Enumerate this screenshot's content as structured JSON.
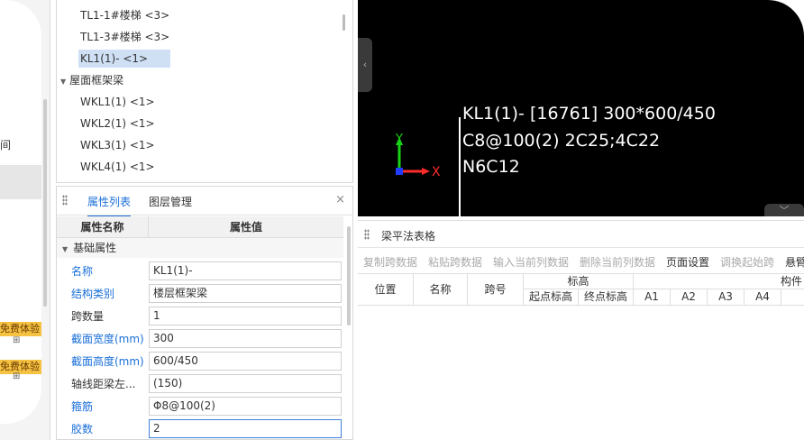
{
  "left_strip": {
    "fragment": "间",
    "badge1": "免费体验",
    "badge2": "免费体验",
    "plus1": "⊞",
    "plus2": "⊞"
  },
  "tree": {
    "items": [
      {
        "label": "TL1-1#楼梯 <3>"
      },
      {
        "label": "TL1-3#楼梯 <3>"
      },
      {
        "label": "KL1(1)- <1>"
      }
    ],
    "group": {
      "label": "屋面框架梁",
      "arrow": "▼"
    },
    "sub_items": [
      {
        "label": "WKL1(1) <1>"
      },
      {
        "label": "WKL2(1) <1>"
      },
      {
        "label": "WKL3(1) <1>"
      },
      {
        "label": "WKL4(1) <1>"
      }
    ]
  },
  "props": {
    "tab_props": "属性列表",
    "tab_layers": "图层管理",
    "close": "×",
    "head_name": "属性名称",
    "head_value": "属性值",
    "group": "基础属性",
    "group_arrow": "▼",
    "rows": [
      {
        "label": "名称",
        "value": "KL1(1)-"
      },
      {
        "label": "结构类别",
        "value": "楼层框架梁"
      },
      {
        "label": "跨数量",
        "value": "1"
      },
      {
        "label": "截面宽度(mm)",
        "value": "300"
      },
      {
        "label": "截面高度(mm)",
        "value": "600/450"
      },
      {
        "label": "轴线距梁左...",
        "value": "(150)"
      },
      {
        "label": "箍筋",
        "value": "Φ8@100(2)"
      },
      {
        "label": "胶数",
        "value": "2"
      }
    ]
  },
  "canvas": {
    "line1": "KL1(1)- [16761] 300*600/450",
    "line2": "C8@100(2) 2C25;4C22",
    "line3": "N6C12",
    "axis_x": "X",
    "axis_y": "Y",
    "left_handle": "‹",
    "right_handle": "﹀",
    "colors": {
      "x_axis": "#ff2a2a",
      "y_axis": "#18d218",
      "origin": "#1f3cff"
    }
  },
  "table": {
    "title": "梁平法表格",
    "toolbar": [
      {
        "label": "复制跨数据",
        "enabled": false
      },
      {
        "label": "粘贴跨数据",
        "enabled": false
      },
      {
        "label": "输入当前列数据",
        "enabled": false
      },
      {
        "label": "删除当前列数据",
        "enabled": false
      },
      {
        "label": "页面设置",
        "enabled": true
      },
      {
        "label": "调换起始跨",
        "enabled": false
      },
      {
        "label": "悬臂",
        "enabled": true
      }
    ],
    "headers": {
      "position": "位置",
      "name": "名称",
      "span": "跨号",
      "elevation": "标高",
      "start_elev": "起点标高",
      "end_elev": "终点标高",
      "a1": "A1",
      "a2": "A2",
      "a3": "A3",
      "a4": "A4",
      "component": "构件"
    }
  }
}
